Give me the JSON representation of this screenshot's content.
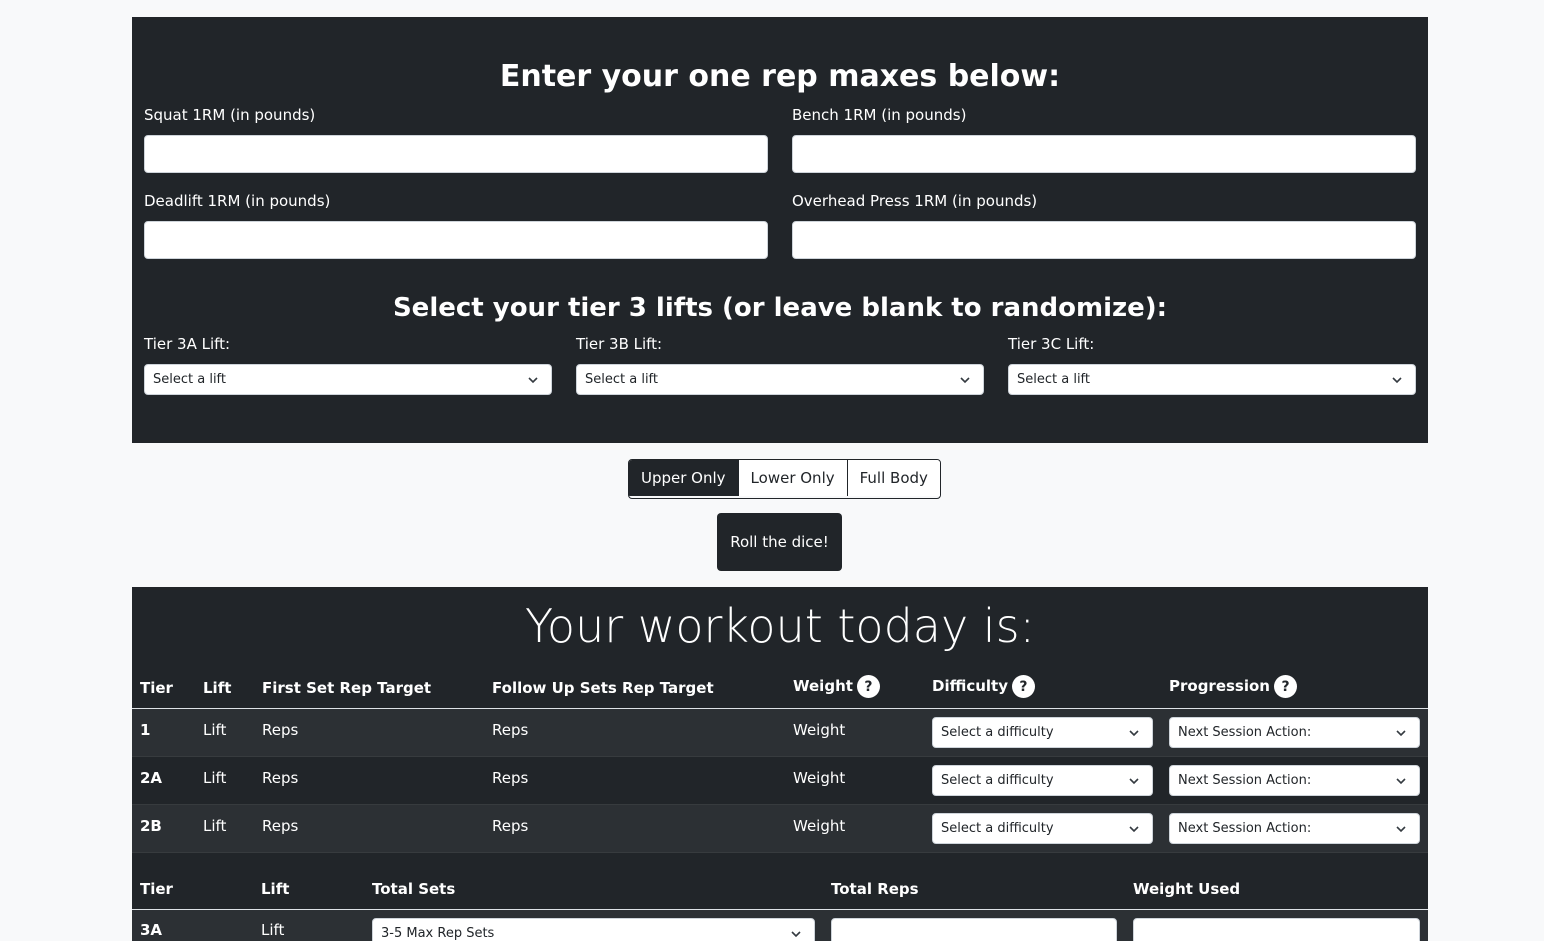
{
  "maxes": {
    "title": "Enter your one rep maxes below:",
    "squat_label": "Squat 1RM (in pounds)",
    "bench_label": "Bench 1RM (in pounds)",
    "deadlift_label": "Deadlift 1RM (in pounds)",
    "ohp_label": "Overhead Press 1RM (in pounds)",
    "squat_value": "",
    "bench_value": "",
    "deadlift_value": "",
    "ohp_value": ""
  },
  "tier3": {
    "title": "Select your tier 3 lifts (or leave blank to randomize):",
    "a_label": "Tier 3A Lift:",
    "b_label": "Tier 3B Lift:",
    "c_label": "Tier 3C Lift:",
    "a_selected": "Select a lift",
    "b_selected": "Select a lift",
    "c_selected": "Select a lift"
  },
  "split": {
    "options": [
      "Upper Only",
      "Lower Only",
      "Full Body"
    ],
    "active": "Upper Only"
  },
  "roll_button": "Roll the dice!",
  "workout": {
    "title": "Your workout today is:",
    "headers": {
      "tier": "Tier",
      "lift": "Lift",
      "first_set": "First Set Rep Target",
      "follow_up": "Follow Up Sets Rep Target",
      "weight": "Weight",
      "difficulty": "Difficulty",
      "progression": "Progression",
      "help": "?"
    },
    "rows": [
      {
        "tier": "1",
        "lift": "Lift",
        "first": "Reps",
        "follow": "Reps",
        "weight": "Weight",
        "difficulty": "Select a difficulty",
        "progression": "Next Session Action:"
      },
      {
        "tier": "2A",
        "lift": "Lift",
        "first": "Reps",
        "follow": "Reps",
        "weight": "Weight",
        "difficulty": "Select a difficulty",
        "progression": "Next Session Action:"
      },
      {
        "tier": "2B",
        "lift": "Lift",
        "first": "Reps",
        "follow": "Reps",
        "weight": "Weight",
        "difficulty": "Select a difficulty",
        "progression": "Next Session Action:"
      }
    ]
  },
  "tier3_table": {
    "headers": {
      "tier": "Tier",
      "lift": "Lift",
      "total_sets": "Total Sets",
      "total_reps": "Total Reps",
      "weight_used": "Weight Used"
    },
    "rows": [
      {
        "tier": "3A",
        "lift": "Lift",
        "total_sets": "3-5 Max Rep Sets",
        "total_reps": "",
        "weight_used": ""
      }
    ]
  }
}
